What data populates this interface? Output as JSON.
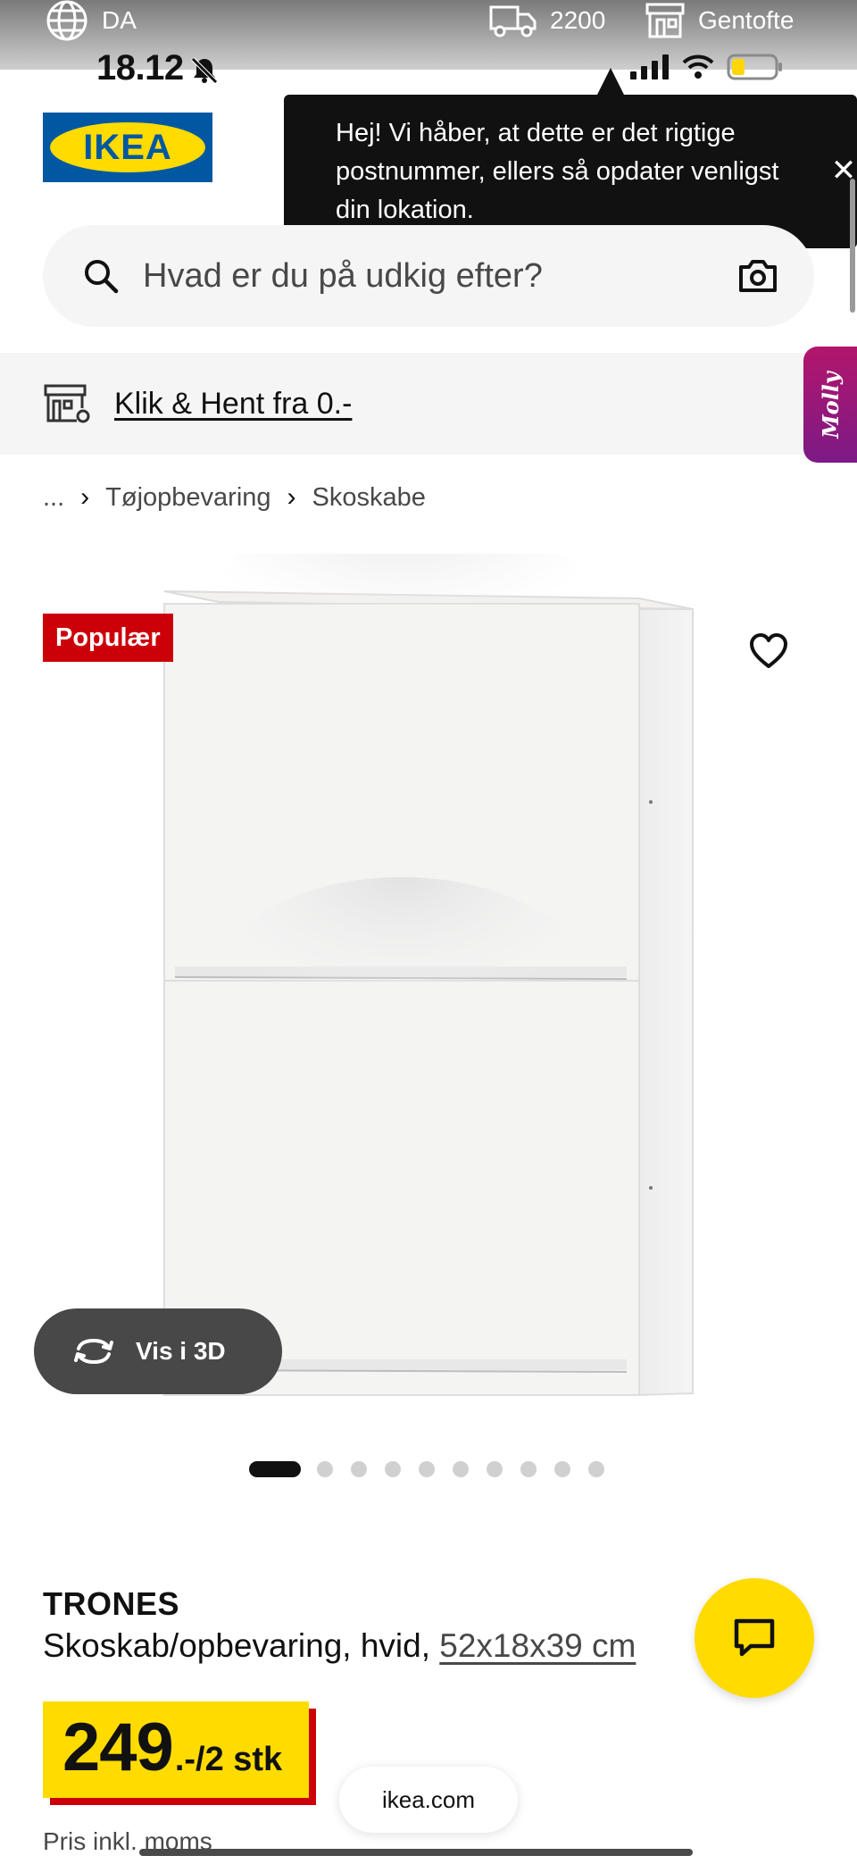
{
  "top_bar": {
    "language": "DA",
    "postal_code": "2200",
    "store": "Gentofte"
  },
  "status_bar": {
    "time": "18.12"
  },
  "brand": {
    "logo_text": "IKEA",
    "blue": "#0058a3",
    "yellow": "#ffdb00"
  },
  "tooltip": {
    "message": "Hej! Vi håber, at dette er det rigtige postnummer, ellers så opdater venligst din lokation.",
    "close": "✕"
  },
  "search": {
    "placeholder": "Hvad er du på udkig efter?"
  },
  "click_collect": {
    "label": "Klik & Hent fra 0.-"
  },
  "molly": {
    "label": "Molly"
  },
  "breadcrumb": {
    "items": [
      "...",
      "Tøjopbevaring",
      "Skoskabe"
    ]
  },
  "product": {
    "badge": "Populær",
    "view_3d": "Vis i 3D",
    "image_count": 10,
    "active_image": 1,
    "name": "TRONES",
    "description": "Skoskab/opbevaring, hvid,",
    "dimensions": "52x18x39 cm",
    "price": "249",
    "price_suffix": ".-/2 stk",
    "price_note": "Pris inkl. moms"
  },
  "browser": {
    "url_pill": "ikea.com"
  },
  "colors": {
    "price_red": "#cc0008",
    "badge_red": "#cc0008",
    "molly_gradient": [
      "#b3166c",
      "#7c1a86"
    ]
  }
}
